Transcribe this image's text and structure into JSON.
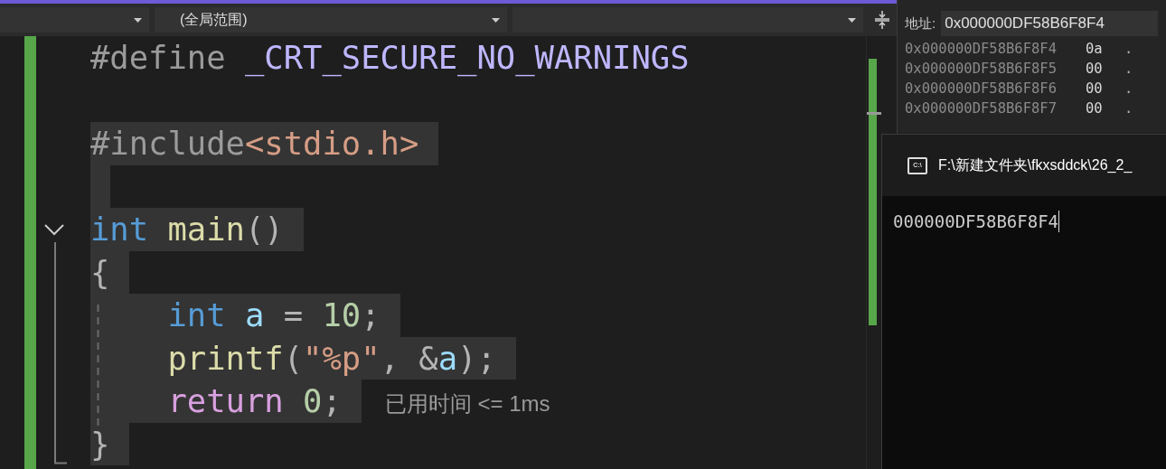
{
  "toolbar": {
    "dropdowns": [
      {
        "kind": "blank"
      },
      {
        "kind": "text",
        "value": "(全局范围)"
      },
      {
        "kind": "blank"
      }
    ]
  },
  "editor": {
    "lines": [
      {
        "selected": false,
        "tokens": [
          {
            "text": "#define ",
            "kind": "directive"
          },
          {
            "text": "_CRT_SECURE_NO_WARNINGS",
            "kind": "macro"
          }
        ]
      },
      {
        "selected": false
      },
      {
        "selected": true,
        "tokens": [
          {
            "text": "#include",
            "kind": "directive"
          },
          {
            "text": "<stdio.h>",
            "kind": "string"
          }
        ]
      },
      {
        "selected": true
      },
      {
        "selected": true,
        "expanded": true,
        "tokens": [
          {
            "text": "int ",
            "kind": "keyword"
          },
          {
            "text": "main",
            "kind": "function"
          },
          {
            "text": "()",
            "kind": "plain"
          }
        ]
      },
      {
        "selected": true,
        "tokens": [
          {
            "text": "{",
            "kind": "plain"
          }
        ]
      },
      {
        "selected": true,
        "tokens": [
          {
            "text": "    int ",
            "kind": "keyword"
          },
          {
            "text": "a",
            "kind": "variable"
          },
          {
            "text": " = ",
            "kind": "plain"
          },
          {
            "text": "10",
            "kind": "number"
          },
          {
            "text": ";",
            "kind": "plain"
          }
        ]
      },
      {
        "selected": true,
        "tokens": [
          {
            "text": "    printf",
            "kind": "function"
          },
          {
            "text": "(",
            "kind": "plain"
          },
          {
            "text": "\"%p\"",
            "kind": "string"
          },
          {
            "text": ", &",
            "kind": "plain"
          },
          {
            "text": "a",
            "kind": "variable"
          },
          {
            "text": ");",
            "kind": "plain"
          }
        ]
      },
      {
        "selected": true,
        "hint": "已用时间 <= 1ms",
        "tokens": [
          {
            "text": "    return ",
            "kind": "control"
          },
          {
            "text": "0",
            "kind": "number"
          },
          {
            "text": ";",
            "kind": "plain"
          }
        ]
      },
      {
        "selected": true,
        "tokens": [
          {
            "text": "}",
            "kind": "plain"
          }
        ]
      }
    ]
  },
  "memory": {
    "address_label": "地址:",
    "address": "0x000000DF58B6F8F4",
    "rows": [
      {
        "address": "0x000000DF58B6F8F4",
        "value": "0a",
        "ascii": "."
      },
      {
        "address": "0x000000DF58B6F8F5",
        "value": "00",
        "ascii": "."
      },
      {
        "address": "0x000000DF58B6F8F6",
        "value": "00",
        "ascii": "."
      },
      {
        "address": "0x000000DF58B6F8F7",
        "value": "00",
        "ascii": "."
      }
    ]
  },
  "console": {
    "title": "F:\\新建文件夹\\fkxsddck\\26_2_",
    "icon_text": "C:\\",
    "output": "000000DF58B6F8F4"
  }
}
